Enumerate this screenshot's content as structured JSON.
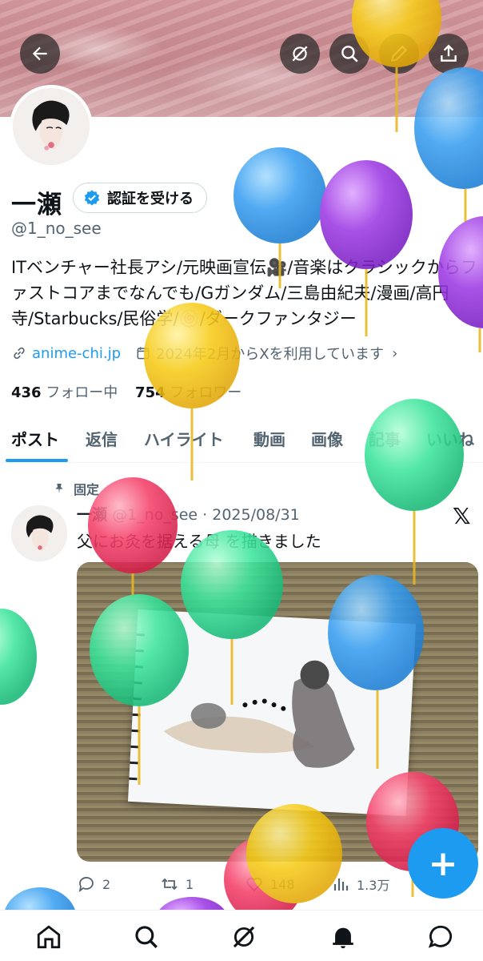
{
  "header": {
    "back_icon": "arrow-left-icon",
    "grok_icon": "grok-icon",
    "search_icon": "search-icon",
    "edit_icon": "pencil-icon",
    "share_icon": "share-icon"
  },
  "profile": {
    "name": "一瀬",
    "verify_label": "認証を受ける",
    "handle": "@1_no_see",
    "bio": "ITベンチャー社長アシ/元映画宣伝🎥/音楽はクラシックからファストコアまでなんでも/Gガンダム/三島由紀夫/漫画/高円寺/Starbucks/民俗学/🍥/ダークファンタジー",
    "website": "anime-chi.jp",
    "joined": "2024年2月からXを利用しています",
    "following_count": "436",
    "following_label": "フォロー中",
    "followers_count": "754",
    "followers_label": "フォロワー"
  },
  "tabs": [
    "ポスト",
    "返信",
    "ハイライト",
    "動画",
    "画像",
    "記事",
    "いいね"
  ],
  "post": {
    "pinned_label": "固定",
    "author_name": "一瀬",
    "author_handle": "@1_no_see",
    "date": "· 2025/08/31",
    "text": "父にお灸を据える母 を描きました",
    "replies": "2",
    "reposts": "1",
    "likes": "148",
    "views": "1.3万"
  },
  "fab_label": "+",
  "colors": {
    "accent": "#1d9bf0",
    "text": "#0f1419",
    "muted": "#536471"
  },
  "bottom_nav": [
    "home-icon",
    "search-icon",
    "grok-icon",
    "notifications-icon",
    "messages-icon"
  ]
}
